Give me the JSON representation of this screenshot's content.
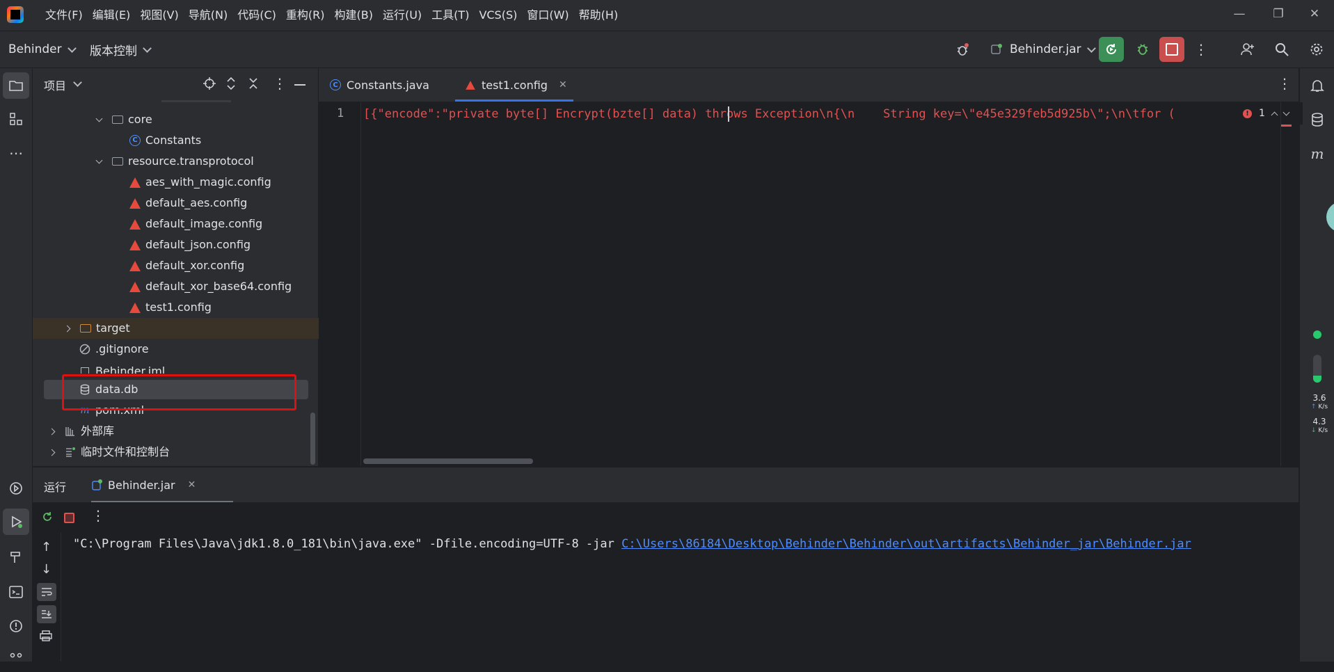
{
  "menu": [
    "文件(F)",
    "编辑(E)",
    "视图(V)",
    "导航(N)",
    "代码(C)",
    "重构(R)",
    "构建(B)",
    "运行(U)",
    "工具(T)",
    "VCS(S)",
    "窗口(W)",
    "帮助(H)"
  ],
  "toolbar": {
    "project_name": "Behinder",
    "vcs_label": "版本控制",
    "run_config": "Behinder.jar"
  },
  "project_panel": {
    "title": "项目",
    "items": [
      {
        "label": "core"
      },
      {
        "label": "Constants"
      },
      {
        "label": "resource.transprotocol"
      },
      {
        "label": "aes_with_magic.config"
      },
      {
        "label": "default_aes.config"
      },
      {
        "label": "default_image.config"
      },
      {
        "label": "default_json.config"
      },
      {
        "label": "default_xor.config"
      },
      {
        "label": "default_xor_base64.config"
      },
      {
        "label": "test1.config"
      },
      {
        "label": "target"
      },
      {
        "label": ".gitignore"
      },
      {
        "label": "Behinder.iml"
      },
      {
        "label": "data.db"
      },
      {
        "label": "pom.xml"
      },
      {
        "label": "外部库"
      },
      {
        "label": "临时文件和控制台"
      }
    ]
  },
  "editor": {
    "tabs": [
      {
        "label": "Constants.java"
      },
      {
        "label": "test1.config"
      }
    ],
    "line_number": "1",
    "code_line": "[{\"encode\":\"private byte[] Encrypt(bzte[] data) throws Exception\\n{\\n    String key=\\\"e45e329feb5d925b\\\";\\n\\tfor (",
    "problem_count": "1"
  },
  "run_panel": {
    "title": "运行",
    "tab": "Behinder.jar",
    "cmd_prefix": "\"C:\\Program Files\\Java\\jdk1.8.0_181\\bin\\java.exe\" -Dfile.encoding=UTF-8 -jar ",
    "cmd_link": "C:\\Users\\86184\\Desktop\\Behinder\\Behinder\\out\\artifacts\\Behinder_jar\\Behinder.jar"
  },
  "net_speed": {
    "up_value": "3.6",
    "up_unit": "K/s",
    "down_value": "4.3",
    "down_unit": "K/s"
  },
  "colors": {
    "accent": "#3574f0",
    "run_green": "#3d8f58",
    "stop_red": "#c94f4f",
    "highlight_box": "#e01010",
    "code_red": "#e05252"
  }
}
